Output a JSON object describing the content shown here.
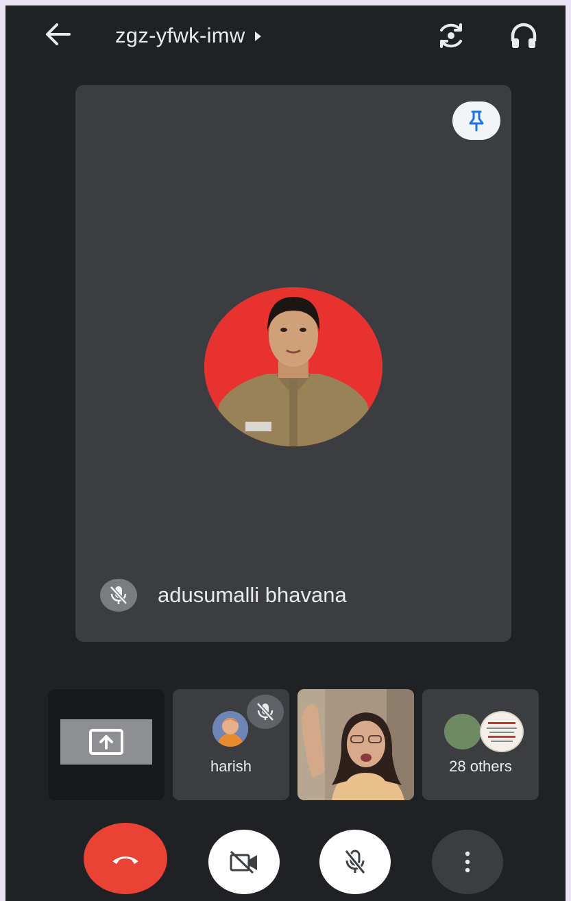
{
  "header": {
    "meeting_code": "zgz-yfwk-imw",
    "icons": [
      "back-arrow-icon",
      "caret-right-icon",
      "switch-camera-icon",
      "headphones-icon"
    ]
  },
  "main_tile": {
    "participant_name": "adusumalli bhavana",
    "pin_icon": "pin-icon",
    "mic_state_icon": "mic-off-icon"
  },
  "strip": {
    "share_tile_icon": "present-screen-icon",
    "harish": {
      "name": "harish",
      "mic_icon": "mic-off-icon"
    },
    "others": {
      "label": "28 others"
    }
  },
  "controls": {
    "end_call_icon": "end-call-icon",
    "camera_icon": "camera-off-icon",
    "mic_icon": "mic-off-icon",
    "more_icon": "more-vert-icon"
  },
  "colors": {
    "background": "#202124",
    "tile": "#3c3d40",
    "end_call": "#ea4335",
    "avatar_bg": "#e8322f",
    "pin_accent": "#1a73e8"
  }
}
